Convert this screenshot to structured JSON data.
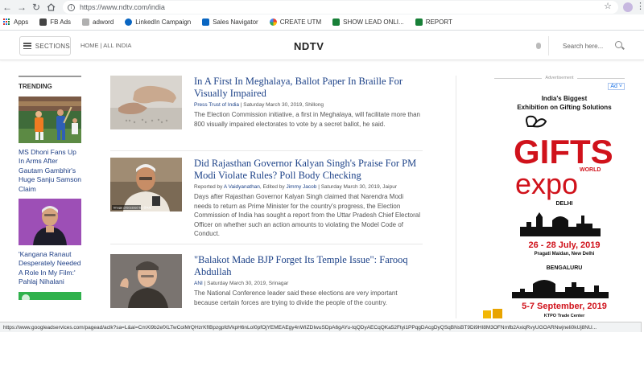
{
  "browser": {
    "url": "https://www.ndtv.com/india",
    "bookmarks": [
      {
        "label": "Apps",
        "icon": "apps-grid-icon"
      },
      {
        "label": "FB Ads",
        "icon": "fb-bookmark-icon",
        "color": "#444444"
      },
      {
        "label": "adword",
        "icon": "folder-icon",
        "color": "#999999"
      },
      {
        "label": "LinkedIn Campaign",
        "icon": "linkedin-campaign-icon",
        "color": "#0a66c2"
      },
      {
        "label": "Sales Navigator",
        "icon": "linkedin-icon",
        "color": "#0a66c2"
      },
      {
        "label": "CREATE UTM",
        "icon": "google-icon",
        "color": "#ea4335"
      },
      {
        "label": "SHOW LEAD ONLI...",
        "icon": "sheets-icon",
        "color": "#188038"
      },
      {
        "label": "REPORT",
        "icon": "sheets-icon",
        "color": "#188038"
      }
    ],
    "status_url": "https://www.googleadservices.com/pagead/aclk?sa=L&ai=CmXi9b2efXLTwCoiMrQHzrKfIBpzgpfdVkpH6nLoI0pfOjYEMEAEgy4nWIZDIwuSDpA6gAYu-tqQDyAECqQKa52Ftyi1PPqgDAcgDyQSqBNsBT9Di9HI8M3OFNmfb2AxiqRvyUGOARNwjneli0kUj8NU..."
  },
  "site": {
    "sections_label": "SECTIONS",
    "breadcrumb": "HOME | ALL INDIA",
    "logo": "NDTV",
    "search_placeholder": "Search here..."
  },
  "trending": {
    "title": "TRENDING",
    "items": [
      {
        "text": "MS Dhoni Fans Up In Arms After Gautam Gambhir's Huge Sanju Samson Claim"
      },
      {
        "text": "'Kangana Ranaut Desperately Needed A Role In My Film:' Pahlaj Nihalani"
      }
    ]
  },
  "articles": [
    {
      "title": "In A First In Meghalaya, Ballot Paper In Braille For Visually Impaired",
      "meta_source": "Press Trust of India",
      "meta_rest": " | Saturday March 30, 2019, Shillong",
      "desc": "The Election Commission initiative, a first in Meghalaya, will facilitate more than 800 visually impaired electorates to vote by a secret ballot, he said."
    },
    {
      "title": "Did Rajasthan Governor Kalyan Singh's Praise For PM Modi Violate Rules? Poll Body Checking",
      "meta_prefix": "Reported by ",
      "meta_source": "A Vaidyanathan",
      "meta_mid": ", Edited by ",
      "meta_editor": "Jimmy Jacob",
      "meta_rest": " | Saturday March 30, 2019, Jaipur",
      "desc": "Days after Rajasthan Governor Kalyan Singh claimed that Narendra Modi needs to return as Prime Minister for the country's progress, the Election Commission of India has sought a report from the Uttar Pradesh Chief Electoral Officer on whether such an action amounts to violating the Model Code of Conduct.",
      "image_caption": "Image processed by @ANI"
    },
    {
      "title": "\"Balakot Made BJP Forget Its Temple Issue\": Farooq Abdullah",
      "meta_source": "ANI",
      "meta_rest": " | Saturday March 30, 2019, Srinagar",
      "desc": "The National Conference leader said these elections are very important because certain forces are trying to divide the people of the country."
    }
  ],
  "ad": {
    "label": "Advertisement",
    "choice": "Ad",
    "headline1": "India's Biggest",
    "headline2": "Exhibition on Gifting Solutions",
    "logo_word1": "GIFTS",
    "logo_small": "WORLD",
    "logo_word2": "expo",
    "city1": "DELHI",
    "date1": "26 - 28 July, 2019",
    "venue1": "Pragati Maidan, New Delhi",
    "city2": "BENGALURU",
    "date2": "5-7 September, 2019",
    "venue2": "KTPO Trade Center",
    "brand_red": "#d0121b"
  }
}
